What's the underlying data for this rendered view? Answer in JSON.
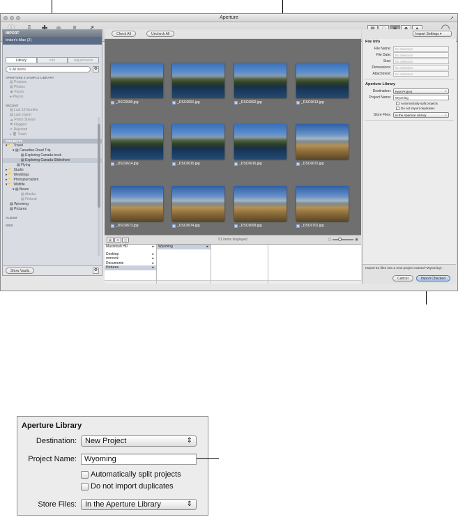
{
  "window": {
    "title": "Aperture"
  },
  "toolbar": {
    "inspector": "Inspector",
    "import": "Import",
    "new": "New",
    "name": "Name",
    "keywords": "Keywords",
    "share": "Share",
    "viewer": "Viewer",
    "loupe": "Loupe"
  },
  "sidebar": {
    "import_header": "IMPORT",
    "device": "tinker's Mac (2)",
    "tabs": [
      "Library",
      "Info",
      "Adjustments"
    ],
    "search_placeholder": "All Items",
    "library_header": "APERTURE 3 SAMPLE LIBRARY",
    "library_items": [
      "Projects",
      "Photos",
      "Faces",
      "Places"
    ],
    "recent_header": "RECENT",
    "recent_items": [
      "Last 12 Months",
      "Last Import",
      "Photo Stream",
      "Flagged",
      "Rejected",
      "Trash"
    ],
    "projects_header": "PROJECTS",
    "projects": {
      "travel": "Travel",
      "canadian": "Canadian Road Trip",
      "book": "Exploring Canada book",
      "slideshow": "Exploring Canada Slideshow",
      "flying": "Flying",
      "studio": "Studio",
      "weddings": "Weddings",
      "photojournalism": "Photojournalism",
      "wildlife": "Wildlife",
      "bears": "Bears",
      "alaska": "Alaska",
      "finland": "Finland",
      "wyoming": "Wyoming",
      "pictures": "Pictures"
    },
    "album_header": "ALBUM",
    "web_header": "WEB",
    "show_vaults": "Show Vaults"
  },
  "center": {
    "check_all": "Check All",
    "uncheck_all": "Uncheck All",
    "thumbnails": [
      "_DSC6590.jpg",
      "_DSC6591.jpg",
      "_DSC6592.jpg",
      "_DSC6613.jpg",
      "_DSC6614.jpg",
      "_DSC6615.jpg",
      "_DSC6616.jpg",
      "_DSC6672.jpg",
      "_DSC6673.jpg",
      "_DSC6674.jpg",
      "_DSC6699.jpg",
      "_DSC6701.jpg"
    ],
    "status": "51 items displayed"
  },
  "browser": {
    "col1": [
      "Macintosh HD",
      "Desktop",
      "romcerk",
      "Documents",
      "Pictures"
    ],
    "col2": [
      "Wyoming"
    ]
  },
  "inspector": {
    "import_settings": "Import Settings",
    "file_info_title": "File Info",
    "file_info": [
      {
        "label": "File Name:",
        "value": "No Selection"
      },
      {
        "label": "File Date:",
        "value": "No Selection"
      },
      {
        "label": "Size:",
        "value": "No Selection"
      },
      {
        "label": "Dimensions:",
        "value": "No Selection"
      },
      {
        "label": "Attachment:",
        "value": "No Selection"
      }
    ],
    "aperture_title": "Aperture Library",
    "destination_label": "Destination:",
    "destination_value": "New Project",
    "project_label": "Project Name:",
    "project_value": "Wyoming",
    "split_label": "Automatically split projects",
    "dupes_label": "Do not import duplicates",
    "store_label": "Store Files:",
    "store_value": "In the Aperture Library",
    "message": "Import 51 files into a new project named \"Wyoming\".",
    "cancel": "Cancel",
    "import_checked": "Import Checked"
  },
  "detail": {
    "title": "Aperture Library",
    "destination_label": "Destination:",
    "destination_value": "New Project",
    "project_label": "Project Name:",
    "project_value": "Wyoming",
    "split_label": "Automatically split projects",
    "dupes_label": "Do not import duplicates",
    "store_label": "Store Files:",
    "store_value": "In the Aperture Library"
  }
}
